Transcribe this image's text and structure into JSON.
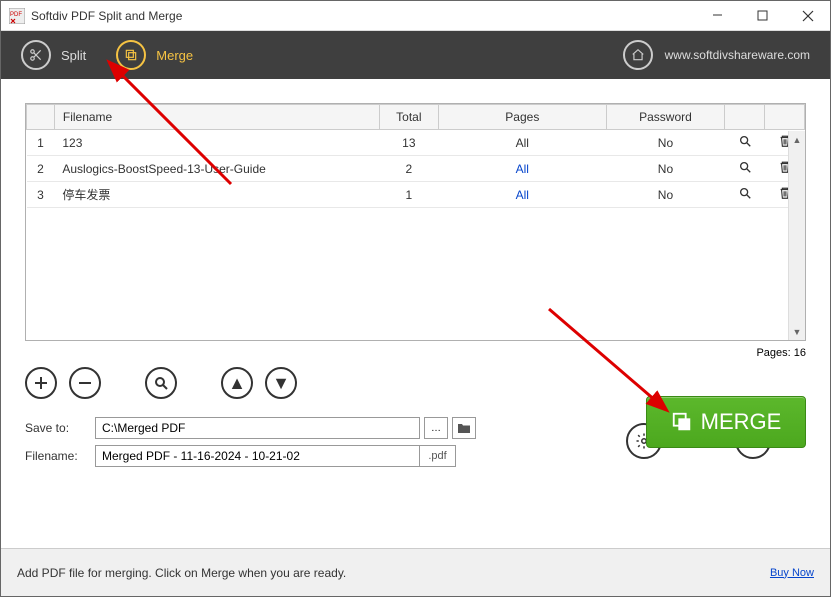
{
  "window": {
    "title": "Softdiv PDF Split and Merge"
  },
  "toolbar": {
    "split_label": "Split",
    "merge_label": "Merge",
    "url": "www.softdivshareware.com"
  },
  "table": {
    "headers": {
      "filename": "Filename",
      "total": "Total",
      "pages": "Pages",
      "password": "Password"
    },
    "rows": [
      {
        "idx": "1",
        "filename": "123",
        "total": "13",
        "pages": "All",
        "pages_link": false,
        "password": "No"
      },
      {
        "idx": "2",
        "filename": "Auslogics-BoostSpeed-13-User-Guide",
        "total": "2",
        "pages": "All",
        "pages_link": true,
        "password": "No"
      },
      {
        "idx": "3",
        "filename": "停车发票",
        "total": "1",
        "pages": "All",
        "pages_link": true,
        "password": "No"
      }
    ]
  },
  "pages_info": "Pages: 16",
  "merge_button": "MERGE",
  "save": {
    "save_to_label": "Save to:",
    "save_to_value": "C:\\Merged PDF",
    "filename_label": "Filename:",
    "filename_value": "Merged PDF - 11-16-2024 - 10-21-02",
    "ext": ".pdf"
  },
  "aux": {
    "settings": "Settings",
    "help": "Help"
  },
  "status": {
    "text": "Add PDF file for merging. Click on Merge when you are ready.",
    "buy": "Buy Now"
  }
}
